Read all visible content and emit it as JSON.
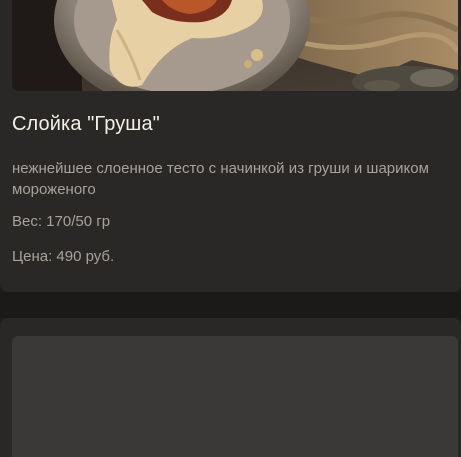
{
  "product": {
    "title": "Слойка \"Груша\"",
    "description": "нежнейшее слоенное тесто с начинкой из груши и шариком мороженого",
    "weight": "Вес: 170/50 гр",
    "price": "Цена: 490 руб."
  },
  "colors": {
    "page_bg": "#1f1d1b",
    "card_bg": "#2a2826",
    "title_text": "#f3efe9",
    "body_text": "#a7a29c",
    "placeholder_bg": "#3a3937"
  }
}
